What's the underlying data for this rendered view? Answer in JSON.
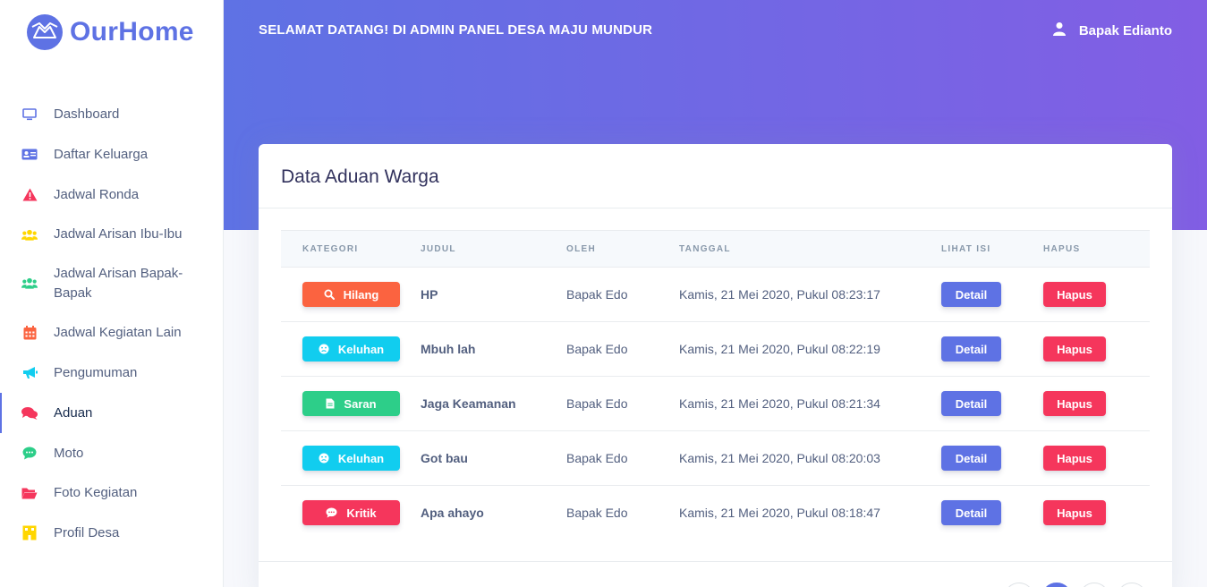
{
  "brand": {
    "name": "OurHome"
  },
  "header": {
    "welcome": "SELAMAT DATANG! DI ADMIN PANEL DESA MAJU MUNDUR",
    "user_name": "Bapak Edianto"
  },
  "sidebar": {
    "items": [
      {
        "label": "Dashboard",
        "icon": "monitor-icon",
        "color": "#5e72e4"
      },
      {
        "label": "Daftar Keluarga",
        "icon": "id-card-icon",
        "color": "#5e72e4"
      },
      {
        "label": "Jadwal Ronda",
        "icon": "warning-icon",
        "color": "#f5365c"
      },
      {
        "label": "Jadwal Arisan Ibu-Ibu",
        "icon": "users-icon",
        "color": "#ffd600"
      },
      {
        "label": "Jadwal Arisan Bapak-\nBapak",
        "icon": "users-icon",
        "color": "#2dce89"
      },
      {
        "label": "Jadwal Kegiatan Lain",
        "icon": "calendar-icon",
        "color": "#fb6340"
      },
      {
        "label": "Pengumuman",
        "icon": "megaphone-icon",
        "color": "#11cdef"
      },
      {
        "label": "Aduan",
        "icon": "chat-icon",
        "color": "#f5365c",
        "active": true
      },
      {
        "label": "Moto",
        "icon": "speech-bubble-icon",
        "color": "#2dce89"
      },
      {
        "label": "Foto Kegiatan",
        "icon": "folder-icon",
        "color": "#f5365c"
      },
      {
        "label": "Profil Desa",
        "icon": "building-icon",
        "color": "#ffd600"
      }
    ]
  },
  "card": {
    "title": "Data Aduan Warga",
    "columns": [
      "KATEGORI",
      "JUDUL",
      "OLEH",
      "TANGGAL",
      "LIHAT ISI",
      "HAPUS"
    ],
    "rows": [
      {
        "category": "Hilang",
        "category_icon": "search-icon",
        "category_color": "#fb6340",
        "title": "HP",
        "author": "Bapak Edo",
        "date": "Kamis, 21 Mei 2020, Pukul 08:23:17",
        "detail": "Detail",
        "delete": "Hapus"
      },
      {
        "category": "Keluhan",
        "category_icon": "frown-icon",
        "category_color": "#11cdef",
        "title": "Mbuh lah",
        "author": "Bapak Edo",
        "date": "Kamis, 21 Mei 2020, Pukul 08:22:19",
        "detail": "Detail",
        "delete": "Hapus"
      },
      {
        "category": "Saran",
        "category_icon": "file-icon",
        "category_color": "#2dce89",
        "title": "Jaga Keamanan",
        "author": "Bapak Edo",
        "date": "Kamis, 21 Mei 2020, Pukul 08:21:34",
        "detail": "Detail",
        "delete": "Hapus"
      },
      {
        "category": "Keluhan",
        "category_icon": "frown-icon",
        "category_color": "#11cdef",
        "title": "Got bau",
        "author": "Bapak Edo",
        "date": "Kamis, 21 Mei 2020, Pukul 08:20:03",
        "detail": "Detail",
        "delete": "Hapus"
      },
      {
        "category": "Kritik",
        "category_icon": "comment-icon",
        "category_color": "#f5365c",
        "title": "Apa ahayo",
        "author": "Bapak Edo",
        "date": "Kamis, 21 Mei 2020, Pukul 08:18:47",
        "detail": "Detail",
        "delete": "Hapus"
      }
    ]
  },
  "colors": {
    "primary": "#5e72e4",
    "gradient_end": "#825ee4",
    "danger": "#f5365c"
  }
}
